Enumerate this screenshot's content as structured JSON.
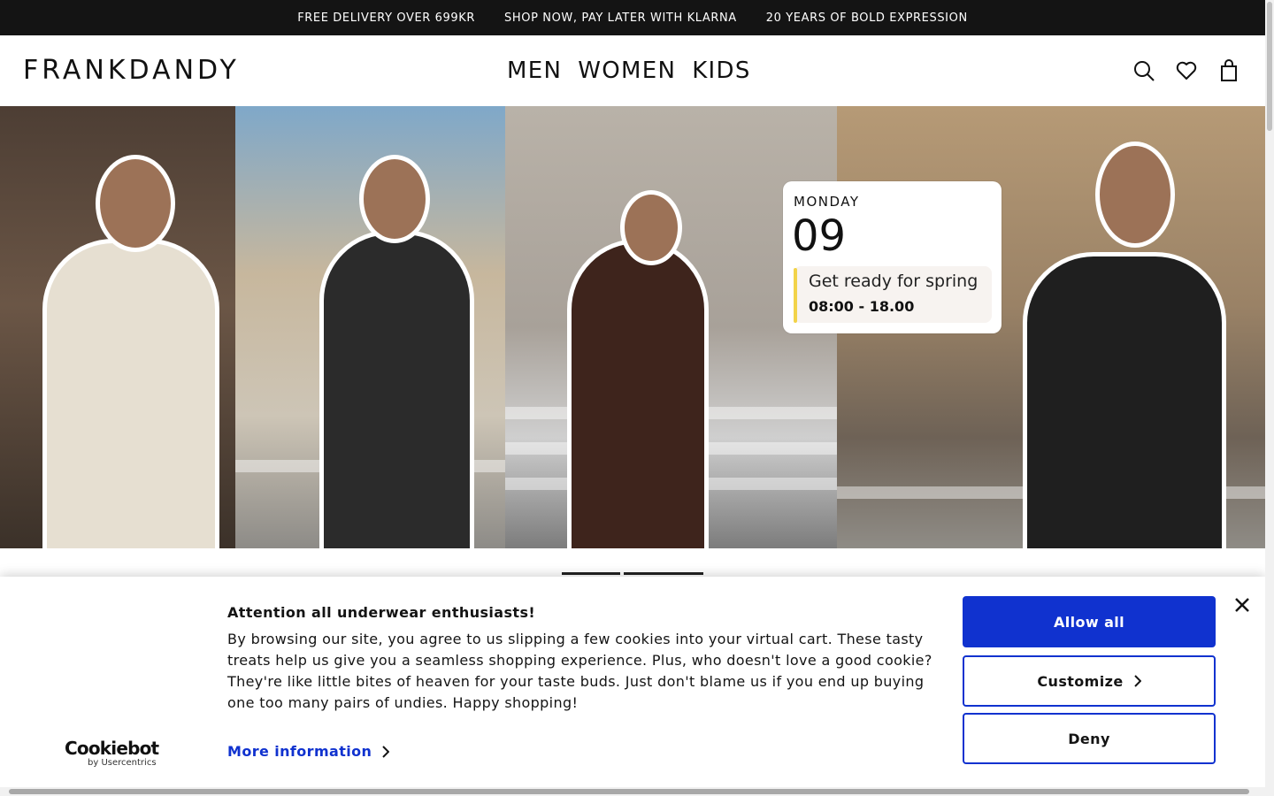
{
  "announcement_bar": {
    "items": [
      "FREE DELIVERY OVER 699KR",
      "SHOP NOW, PAY LATER WITH KLARNA",
      "20 YEARS OF BOLD EXPRESSION"
    ]
  },
  "header": {
    "logo": "FRANKDANDY",
    "nav": [
      "MEN",
      "WOMEN",
      "KIDS"
    ],
    "icons": [
      "search-icon",
      "heart-icon",
      "bag-icon"
    ]
  },
  "hero": {
    "event_card": {
      "day": "MONDAY",
      "date": "09",
      "title": "Get ready for spring",
      "time": "08:00 - 18.00"
    }
  },
  "cookie_banner": {
    "brand": "Cookiebot",
    "brand_sub": "by Usercentrics",
    "title": "Attention all underwear enthusiasts!",
    "body": "By browsing our site, you agree to us slipping a few cookies into your virtual cart. These tasty treats help us give you a seamless shopping experience. Plus, who doesn't love a good cookie? They're like little bites of heaven for your taste buds. Just don't blame us if you end up buying one too many pairs of undies. Happy shopping!",
    "more_info": "More information",
    "buttons": {
      "allow_all": "Allow all",
      "customize": "Customize",
      "deny": "Deny"
    },
    "accent_color": "#1032cf"
  }
}
